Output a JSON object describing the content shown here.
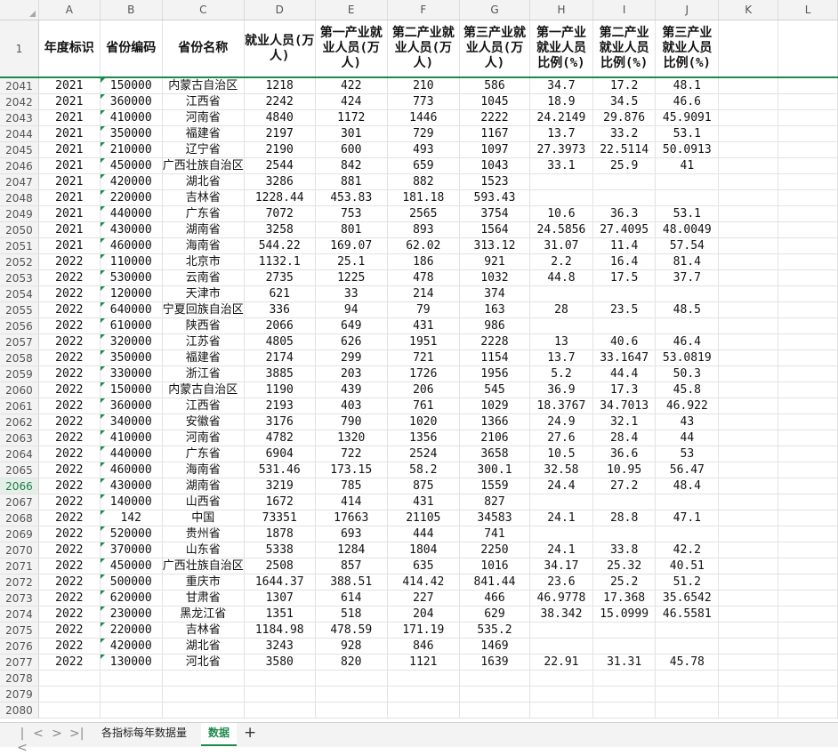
{
  "columns": [
    "A",
    "B",
    "C",
    "D",
    "E",
    "F",
    "G",
    "H",
    "I",
    "J",
    "K",
    "L"
  ],
  "header_row_number": "1",
  "headers": [
    "年度标识",
    "省份编码",
    "省份名称",
    "就业人员(万人)",
    "第一产业就业人员(万人)",
    "第二产业就业人员(万人)",
    "第三产业就业人员(万人)",
    "第一产业就业人员比例(%)",
    "第二产业就业人员比例(%)",
    "第三产业就业人员比例(%)",
    "",
    ""
  ],
  "active_row": "2066",
  "rows": [
    {
      "n": "2041",
      "v": [
        "2021",
        "150000",
        "内蒙古自治区",
        "1218",
        "422",
        "210",
        "586",
        "34.7",
        "17.2",
        "48.1"
      ]
    },
    {
      "n": "2042",
      "v": [
        "2021",
        "360000",
        "江西省",
        "2242",
        "424",
        "773",
        "1045",
        "18.9",
        "34.5",
        "46.6"
      ]
    },
    {
      "n": "2043",
      "v": [
        "2021",
        "410000",
        "河南省",
        "4840",
        "1172",
        "1446",
        "2222",
        "24.2149",
        "29.876",
        "45.9091"
      ]
    },
    {
      "n": "2044",
      "v": [
        "2021",
        "350000",
        "福建省",
        "2197",
        "301",
        "729",
        "1167",
        "13.7",
        "33.2",
        "53.1"
      ]
    },
    {
      "n": "2045",
      "v": [
        "2021",
        "210000",
        "辽宁省",
        "2190",
        "600",
        "493",
        "1097",
        "27.3973",
        "22.5114",
        "50.0913"
      ]
    },
    {
      "n": "2046",
      "v": [
        "2021",
        "450000",
        "广西壮族自治区",
        "2544",
        "842",
        "659",
        "1043",
        "33.1",
        "25.9",
        "41"
      ]
    },
    {
      "n": "2047",
      "v": [
        "2021",
        "420000",
        "湖北省",
        "3286",
        "881",
        "882",
        "1523",
        "",
        "",
        ""
      ]
    },
    {
      "n": "2048",
      "v": [
        "2021",
        "220000",
        "吉林省",
        "1228.44",
        "453.83",
        "181.18",
        "593.43",
        "",
        "",
        ""
      ]
    },
    {
      "n": "2049",
      "v": [
        "2021",
        "440000",
        "广东省",
        "7072",
        "753",
        "2565",
        "3754",
        "10.6",
        "36.3",
        "53.1"
      ]
    },
    {
      "n": "2050",
      "v": [
        "2021",
        "430000",
        "湖南省",
        "3258",
        "801",
        "893",
        "1564",
        "24.5856",
        "27.4095",
        "48.0049"
      ]
    },
    {
      "n": "2051",
      "v": [
        "2021",
        "460000",
        "海南省",
        "544.22",
        "169.07",
        "62.02",
        "313.12",
        "31.07",
        "11.4",
        "57.54"
      ]
    },
    {
      "n": "2052",
      "v": [
        "2022",
        "110000",
        "北京市",
        "1132.1",
        "25.1",
        "186",
        "921",
        "2.2",
        "16.4",
        "81.4"
      ]
    },
    {
      "n": "2053",
      "v": [
        "2022",
        "530000",
        "云南省",
        "2735",
        "1225",
        "478",
        "1032",
        "44.8",
        "17.5",
        "37.7"
      ]
    },
    {
      "n": "2054",
      "v": [
        "2022",
        "120000",
        "天津市",
        "621",
        "33",
        "214",
        "374",
        "",
        "",
        ""
      ]
    },
    {
      "n": "2055",
      "v": [
        "2022",
        "640000",
        "宁夏回族自治区",
        "336",
        "94",
        "79",
        "163",
        "28",
        "23.5",
        "48.5"
      ]
    },
    {
      "n": "2056",
      "v": [
        "2022",
        "610000",
        "陕西省",
        "2066",
        "649",
        "431",
        "986",
        "",
        "",
        ""
      ]
    },
    {
      "n": "2057",
      "v": [
        "2022",
        "320000",
        "江苏省",
        "4805",
        "626",
        "1951",
        "2228",
        "13",
        "40.6",
        "46.4"
      ]
    },
    {
      "n": "2058",
      "v": [
        "2022",
        "350000",
        "福建省",
        "2174",
        "299",
        "721",
        "1154",
        "13.7",
        "33.1647",
        "53.0819"
      ]
    },
    {
      "n": "2059",
      "v": [
        "2022",
        "330000",
        "浙江省",
        "3885",
        "203",
        "1726",
        "1956",
        "5.2",
        "44.4",
        "50.3"
      ]
    },
    {
      "n": "2060",
      "v": [
        "2022",
        "150000",
        "内蒙古自治区",
        "1190",
        "439",
        "206",
        "545",
        "36.9",
        "17.3",
        "45.8"
      ]
    },
    {
      "n": "2061",
      "v": [
        "2022",
        "360000",
        "江西省",
        "2193",
        "403",
        "761",
        "1029",
        "18.3767",
        "34.7013",
        "46.922"
      ]
    },
    {
      "n": "2062",
      "v": [
        "2022",
        "340000",
        "安徽省",
        "3176",
        "790",
        "1020",
        "1366",
        "24.9",
        "32.1",
        "43"
      ]
    },
    {
      "n": "2063",
      "v": [
        "2022",
        "410000",
        "河南省",
        "4782",
        "1320",
        "1356",
        "2106",
        "27.6",
        "28.4",
        "44"
      ]
    },
    {
      "n": "2064",
      "v": [
        "2022",
        "440000",
        "广东省",
        "6904",
        "722",
        "2524",
        "3658",
        "10.5",
        "36.6",
        "53"
      ]
    },
    {
      "n": "2065",
      "v": [
        "2022",
        "460000",
        "海南省",
        "531.46",
        "173.15",
        "58.2",
        "300.1",
        "32.58",
        "10.95",
        "56.47"
      ]
    },
    {
      "n": "2066",
      "v": [
        "2022",
        "430000",
        "湖南省",
        "3219",
        "785",
        "875",
        "1559",
        "24.4",
        "27.2",
        "48.4"
      ]
    },
    {
      "n": "2067",
      "v": [
        "2022",
        "140000",
        "山西省",
        "1672",
        "414",
        "431",
        "827",
        "",
        "",
        ""
      ]
    },
    {
      "n": "2068",
      "v": [
        "2022",
        "142",
        "中国",
        "73351",
        "17663",
        "21105",
        "34583",
        "24.1",
        "28.8",
        "47.1"
      ]
    },
    {
      "n": "2069",
      "v": [
        "2022",
        "520000",
        "贵州省",
        "1878",
        "693",
        "444",
        "741",
        "",
        "",
        ""
      ]
    },
    {
      "n": "2070",
      "v": [
        "2022",
        "370000",
        "山东省",
        "5338",
        "1284",
        "1804",
        "2250",
        "24.1",
        "33.8",
        "42.2"
      ]
    },
    {
      "n": "2071",
      "v": [
        "2022",
        "450000",
        "广西壮族自治区",
        "2508",
        "857",
        "635",
        "1016",
        "34.17",
        "25.32",
        "40.51"
      ]
    },
    {
      "n": "2072",
      "v": [
        "2022",
        "500000",
        "重庆市",
        "1644.37",
        "388.51",
        "414.42",
        "841.44",
        "23.6",
        "25.2",
        "51.2"
      ]
    },
    {
      "n": "2073",
      "v": [
        "2022",
        "620000",
        "甘肃省",
        "1307",
        "614",
        "227",
        "466",
        "46.9778",
        "17.368",
        "35.6542"
      ]
    },
    {
      "n": "2074",
      "v": [
        "2022",
        "230000",
        "黑龙江省",
        "1351",
        "518",
        "204",
        "629",
        "38.342",
        "15.0999",
        "46.5581"
      ]
    },
    {
      "n": "2075",
      "v": [
        "2022",
        "220000",
        "吉林省",
        "1184.98",
        "478.59",
        "171.19",
        "535.2",
        "",
        "",
        ""
      ]
    },
    {
      "n": "2076",
      "v": [
        "2022",
        "420000",
        "湖北省",
        "3243",
        "928",
        "846",
        "1469",
        "",
        "",
        ""
      ]
    },
    {
      "n": "2077",
      "v": [
        "2022",
        "130000",
        "河北省",
        "3580",
        "820",
        "1121",
        "1639",
        "22.91",
        "31.31",
        "45.78"
      ]
    },
    {
      "n": "2078",
      "v": [
        "",
        "",
        "",
        "",
        "",
        "",
        "",
        "",
        "",
        ""
      ]
    },
    {
      "n": "2079",
      "v": [
        "",
        "",
        "",
        "",
        "",
        "",
        "",
        "",
        "",
        ""
      ]
    },
    {
      "n": "2080",
      "v": [
        "",
        "",
        "",
        "",
        "",
        "",
        "",
        "",
        "",
        ""
      ]
    }
  ],
  "sheet_tabs": [
    "各指标每年数据量",
    "数据"
  ],
  "active_tab": "数据",
  "nav_icons": {
    "first": "|<",
    "prev": "<",
    "next": ">",
    "last": ">|"
  },
  "add_tab_label": "+",
  "accent_color": "#1e8a4c"
}
